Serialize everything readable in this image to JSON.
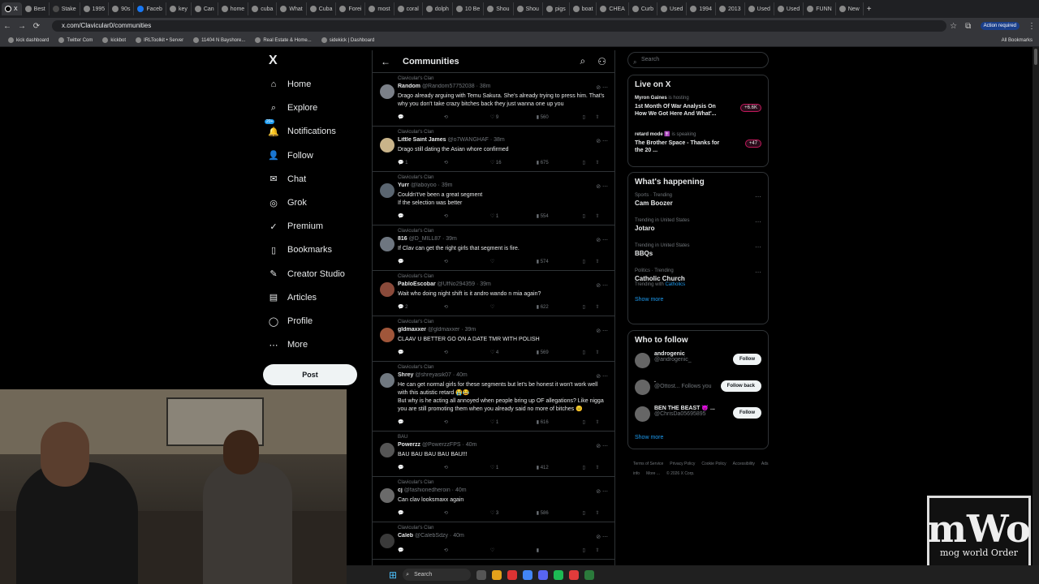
{
  "browser": {
    "tabs": [
      "X",
      "Best",
      "Stake",
      "1995",
      "90s",
      "Faceb",
      "key",
      "Can",
      "home",
      "cuba",
      "What",
      "Cuba",
      "Forei",
      "most",
      "coral",
      "dolph",
      "10 Be",
      "Shou",
      "Shou",
      "pigs",
      "boat",
      "CHEA",
      "Curb",
      "Used",
      "1994",
      "2013",
      "Used",
      "Used",
      "FUNN",
      "New"
    ],
    "url": "x.com/Clavicular0/communities",
    "action_required": "Action required",
    "bookmarks": [
      "kick dashboard",
      "Twitter Com",
      "kickbot",
      "IRLToolkit • Server",
      "11404 N Bayshore...",
      "Real Estate & Home...",
      "sidekick | Dashboard"
    ],
    "all_bookmarks": "All Bookmarks"
  },
  "nav": {
    "logo": "X",
    "items": [
      "Home",
      "Explore",
      "Notifications",
      "Follow",
      "Chat",
      "Grok",
      "Premium",
      "Bookmarks",
      "Creator Studio",
      "Articles",
      "Profile",
      "More"
    ],
    "notifications_badge": "20+",
    "post_label": "Post"
  },
  "feed": {
    "title": "Communities",
    "posts": [
      {
        "community": "Clavicular's Clan",
        "name": "Random",
        "handle": "@Random57752038 · 38m",
        "text": "Drago already arguing with Temu Sakura. She's already trying to press him. That's why you don't take crazy bitches back they just wanna one up you",
        "replies": "",
        "reposts": "",
        "likes": "9",
        "views": "560"
      },
      {
        "community": "Clavicular's Clan",
        "name": "Little Saint James",
        "handle": "@o7WANGHAF · 38m",
        "text": "Drago still dating the Asian whore confirmed",
        "replies": "1",
        "reposts": "",
        "likes": "16",
        "views": "675"
      },
      {
        "community": "Clavicular's Clan",
        "name": "Yurr",
        "handle": "@laboyoo · 39m",
        "text": "Couldn't've been a great segment\nIf the selection was better",
        "replies": "",
        "reposts": "",
        "likes": "1",
        "views": "554"
      },
      {
        "community": "Clavicular's Clan",
        "name": "816",
        "handle": "@D_MILL87 · 39m",
        "text": "If Clav can get the right girls that segment is fire.",
        "replies": "",
        "reposts": "",
        "likes": "",
        "views": "574"
      },
      {
        "community": "Clavicular's Clan",
        "name": "PabloEscobar",
        "handle": "@UfNo294359 · 39m",
        "text": "Wait who doing night shift is it andro wando n mia again?",
        "replies": "2",
        "reposts": "",
        "likes": "",
        "views": "622"
      },
      {
        "community": "Clavicular's Clan",
        "name": "gldmaxxer",
        "handle": "@gldmaxxer · 39m",
        "text": "CLAAV U BETTER GO ON A DATE TMR WITH POLISH",
        "replies": "",
        "reposts": "",
        "likes": "4",
        "views": "569"
      },
      {
        "community": "Clavicular's Clan",
        "name": "Shrey",
        "handle": "@shreyasik07 · 40m",
        "text": "He can get normal girls for these segments but let's be honest it won't work well with this autistic retard 😭😂\nBut why is he acting all annoyed when people bring up OF allegations? Like nigga you are still promoting them when you already said no more of bitches 😐",
        "replies": "",
        "reposts": "",
        "likes": "1",
        "views": "616"
      },
      {
        "community": "BAU",
        "name": "Powerzz",
        "handle": "@PowerzzFPS · 40m",
        "text": "BAU BAU BAU BAU BAU!!!",
        "replies": "",
        "reposts": "",
        "likes": "1",
        "views": "412"
      },
      {
        "community": "Clavicular's Clan",
        "name": "cj",
        "handle": "@fashionedheroin · 40m",
        "text": "Can clav looksmaxx again",
        "replies": "",
        "reposts": "",
        "likes": "3",
        "views": "586"
      },
      {
        "community": "Clavicular's Clan",
        "name": "Caleb",
        "handle": "@CalebSdzy · 40m",
        "text": "",
        "replies": "",
        "reposts": "",
        "likes": "",
        "views": ""
      }
    ]
  },
  "sidebar": {
    "search_placeholder": "Search",
    "live": {
      "title": "Live on X",
      "items": [
        {
          "host": "Myron Gaines",
          "status": "is hosting",
          "title": "1st Month Of War Analysis On How We Got Here And What'...",
          "count": "+6.6K"
        },
        {
          "host": "retard mode ✝️",
          "status": "is speaking",
          "title": "The Brother Space - Thanks for the 20 ...",
          "count": "+47"
        }
      ]
    },
    "happening": {
      "title": "What's happening",
      "items": [
        {
          "cat": "Sports · Trending",
          "name": "Cam Boozer",
          "with": ""
        },
        {
          "cat": "Trending in United States",
          "name": "Jotaro",
          "with": ""
        },
        {
          "cat": "Trending in United States",
          "name": "BBQs",
          "with": ""
        },
        {
          "cat": "Politics · Trending",
          "name": "Catholic Church",
          "with": "Catholics"
        }
      ],
      "with_label": "Trending with",
      "show_more": "Show more"
    },
    "who": {
      "title": "Who to follow",
      "items": [
        {
          "name": "androgenic",
          "handle": "@androgenic_",
          "btn": "Follow"
        },
        {
          "name": ".",
          "handle": "@Ottost...  Follows you",
          "btn": "Follow back"
        },
        {
          "name": "BEN THE BEAST 😈 ...",
          "handle": "@ChrisDa05695895",
          "btn": "Follow"
        }
      ],
      "show_more": "Show more"
    },
    "footer": [
      "Terms of Service",
      "Privacy Policy",
      "Cookie Policy",
      "Accessibility",
      "Ads info",
      "More ...",
      "© 2026 X Corp."
    ]
  },
  "overlay": {
    "watermark_top": "mWo",
    "watermark_bottom": "mog world Order"
  },
  "taskbar": {
    "search": "Search"
  }
}
